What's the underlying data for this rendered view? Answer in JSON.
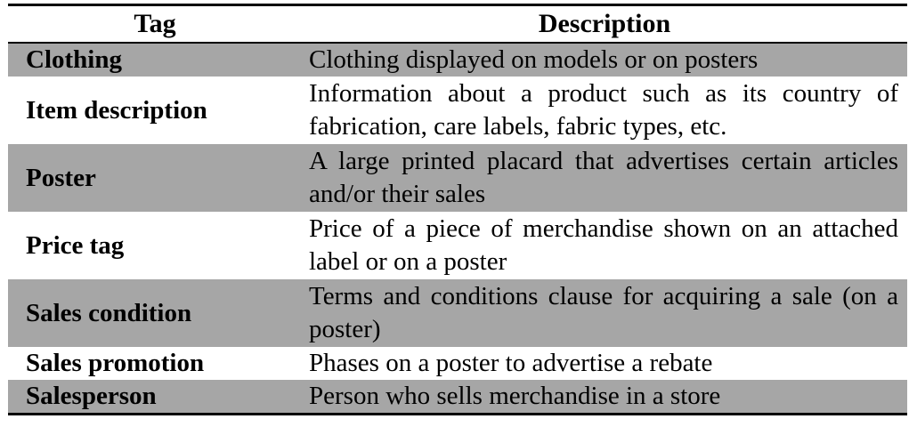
{
  "table": {
    "headers": {
      "tag": "Tag",
      "description": "Description"
    },
    "rows": [
      {
        "tag": "Clothing",
        "description": "Clothing displayed on models or on posters",
        "shaded": true,
        "lines": 1
      },
      {
        "tag": "Item description",
        "description": "Information about a product such as its country of fabrication, care labels, fabric types, etc.",
        "shaded": false,
        "lines": 2
      },
      {
        "tag": "Poster",
        "description": "A large printed placard that advertises certain articles and/or their sales",
        "shaded": true,
        "lines": 2
      },
      {
        "tag": "Price tag",
        "description": "Price of a piece of merchandise shown on an attached label or on a poster",
        "shaded": false,
        "lines": 2
      },
      {
        "tag": "Sales condition",
        "description": "Terms and conditions clause for acquiring a sale (on a poster)",
        "shaded": true,
        "lines": 2
      },
      {
        "tag": "Sales promotion",
        "description": "Phases on a poster to advertise a rebate",
        "shaded": false,
        "lines": 1
      },
      {
        "tag": "Salesperson",
        "description": "Person who sells merchandise in a store",
        "shaded": true,
        "lines": 1
      }
    ]
  }
}
